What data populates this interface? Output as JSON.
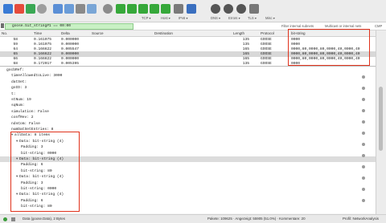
{
  "toolbar": {
    "dropdowns": [
      "TCP",
      "Host",
      "IPv6",
      "DNS",
      "Errors",
      "TLS",
      "Misc"
    ],
    "colors": {
      "shark_blue": "#3a7bd5",
      "stop_red": "#e54b3c",
      "arrow_green": "#36a83a"
    }
  },
  "filter": {
    "value": "goose.bit_string#1 == 00:00",
    "links": [
      "Filter internal subnets",
      "Multicast or internal nets",
      "CMP"
    ]
  },
  "packet_list": {
    "columns": [
      "No.",
      "Time",
      "Delta",
      "Source",
      "Destination",
      "Length",
      "Protocol",
      "bit-string"
    ],
    "rows": [
      [
        "58",
        "0.161075",
        "0.000000",
        "",
        "",
        "135",
        "GOOSE",
        "0000"
      ],
      [
        "59",
        "0.161075",
        "0.000000",
        "",
        "",
        "135",
        "GOOSE",
        "0000"
      ],
      [
        "64",
        "0.166622",
        "0.005547",
        "",
        "",
        "165",
        "GOOSE",
        "0000,80,0000,80,0000,40,0000,40"
      ],
      [
        "65",
        "0.166622",
        "0.000000",
        "",
        "",
        "165",
        "GOOSE",
        "0000,80,0000,80,0000,40,0000,40"
      ],
      [
        "66",
        "0.166622",
        "0.000000",
        "",
        "",
        "165",
        "GOOSE",
        "0000,80,0000,80,0000,40,0000,40"
      ],
      [
        "68",
        "0.172017",
        "0.005395",
        "",
        "",
        "135",
        "GOOSE",
        "0000"
      ]
    ]
  },
  "details": [
    {
      "text": "gocbRef:",
      "indent": 0
    },
    {
      "text": "timeAllowedtoLive: 3000",
      "indent": 1
    },
    {
      "text": "datSet:",
      "indent": 1
    },
    {
      "text": "goID: 3",
      "indent": 1
    },
    {
      "text": "t:",
      "indent": 1
    },
    {
      "text": "stNum: 19",
      "indent": 1
    },
    {
      "text": "sqNum:",
      "indent": 1
    },
    {
      "text": "simulation: False",
      "indent": 1
    },
    {
      "text": "confRev: 2",
      "indent": 1
    },
    {
      "text": "ndsCom: False",
      "indent": 1
    },
    {
      "text": "numDatSetEntries: 8",
      "indent": 1
    },
    {
      "text": "allData: 8 items",
      "indent": 1,
      "tri": "▾"
    },
    {
      "text": "Data: bit-string (4)",
      "indent": 2,
      "tri": "▾"
    },
    {
      "text": "Padding: 3",
      "indent": 3
    },
    {
      "text": "bit-string: 0000",
      "indent": 3
    },
    {
      "text": "Data: bit-string (4)",
      "indent": 2,
      "tri": "▾",
      "hl": true
    },
    {
      "text": "Padding: 6",
      "indent": 3
    },
    {
      "text": "bit-string: 80",
      "indent": 3
    },
    {
      "text": "Data: bit-string (4)",
      "indent": 2,
      "tri": "▾"
    },
    {
      "text": "Padding: 3",
      "indent": 3
    },
    {
      "text": "bit-string: 0000",
      "indent": 3
    },
    {
      "text": "Data: bit-string (4)",
      "indent": 2,
      "tri": "▾"
    },
    {
      "text": "Padding: 6",
      "indent": 3
    },
    {
      "text": "bit-string: 80",
      "indent": 3
    }
  ],
  "status": {
    "left": "Data (goose.Data), 2 Bytes",
    "right": "Pakete: 109625 · Angezeigt: 55905 (51.0%) · Kommentare: 20",
    "profile": "Profil: NetworkAnalysis"
  }
}
